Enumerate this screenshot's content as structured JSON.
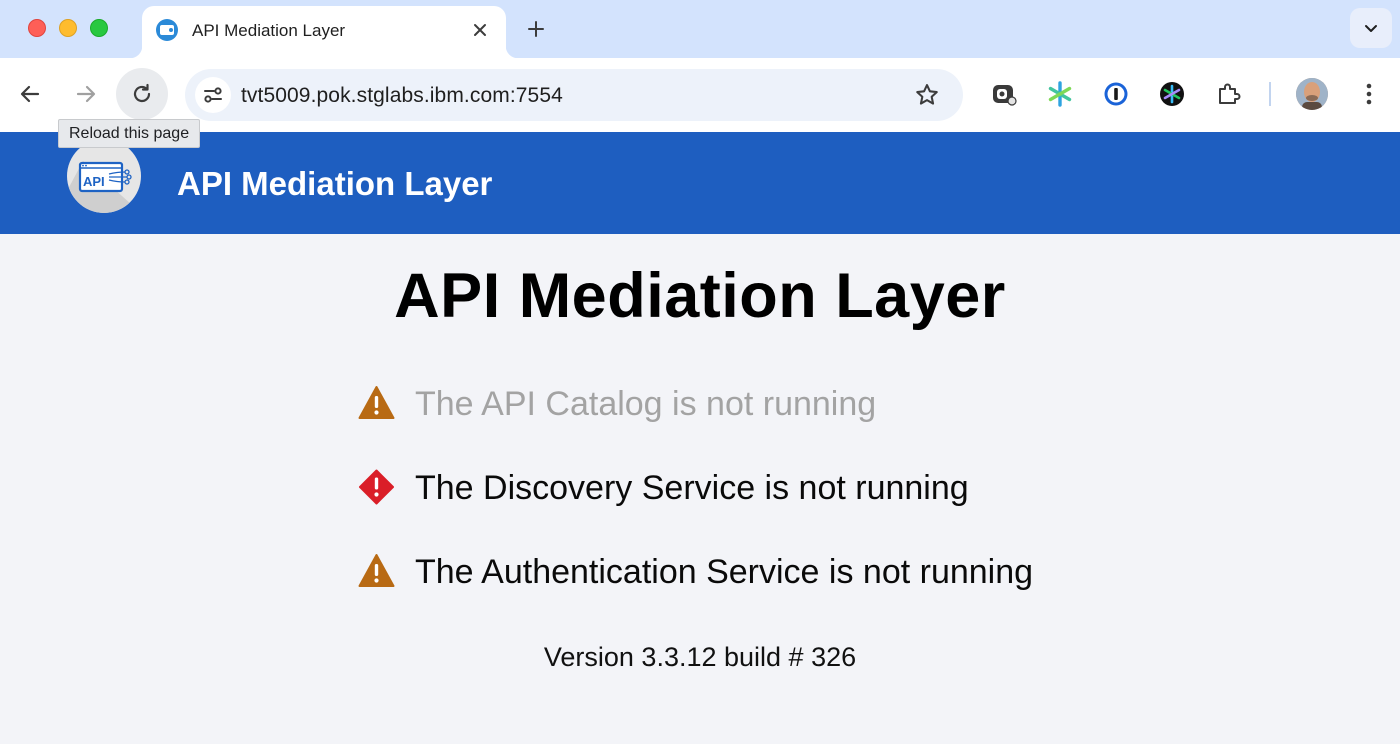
{
  "browser": {
    "tab_title": "API Mediation Layer",
    "url": "tvt5009.pok.stglabs.ibm.com:7554",
    "reload_tooltip": "Reload this page"
  },
  "header": {
    "logo_text": "API",
    "title": "API Mediation Layer",
    "background_color": "#1e5ec0"
  },
  "main": {
    "title": "API Mediation Layer",
    "statuses": [
      {
        "icon": "warning-triangle-icon",
        "text": "The API Catalog is not running",
        "muted": true,
        "color": "#b86a14"
      },
      {
        "icon": "error-diamond-icon",
        "text": "The Discovery Service is not running",
        "muted": false,
        "color": "#da1e28"
      },
      {
        "icon": "warning-triangle-icon",
        "text": "The Authentication Service is not running",
        "muted": false,
        "color": "#b86a14"
      }
    ],
    "version": "Version 3.3.12 build # 326"
  }
}
